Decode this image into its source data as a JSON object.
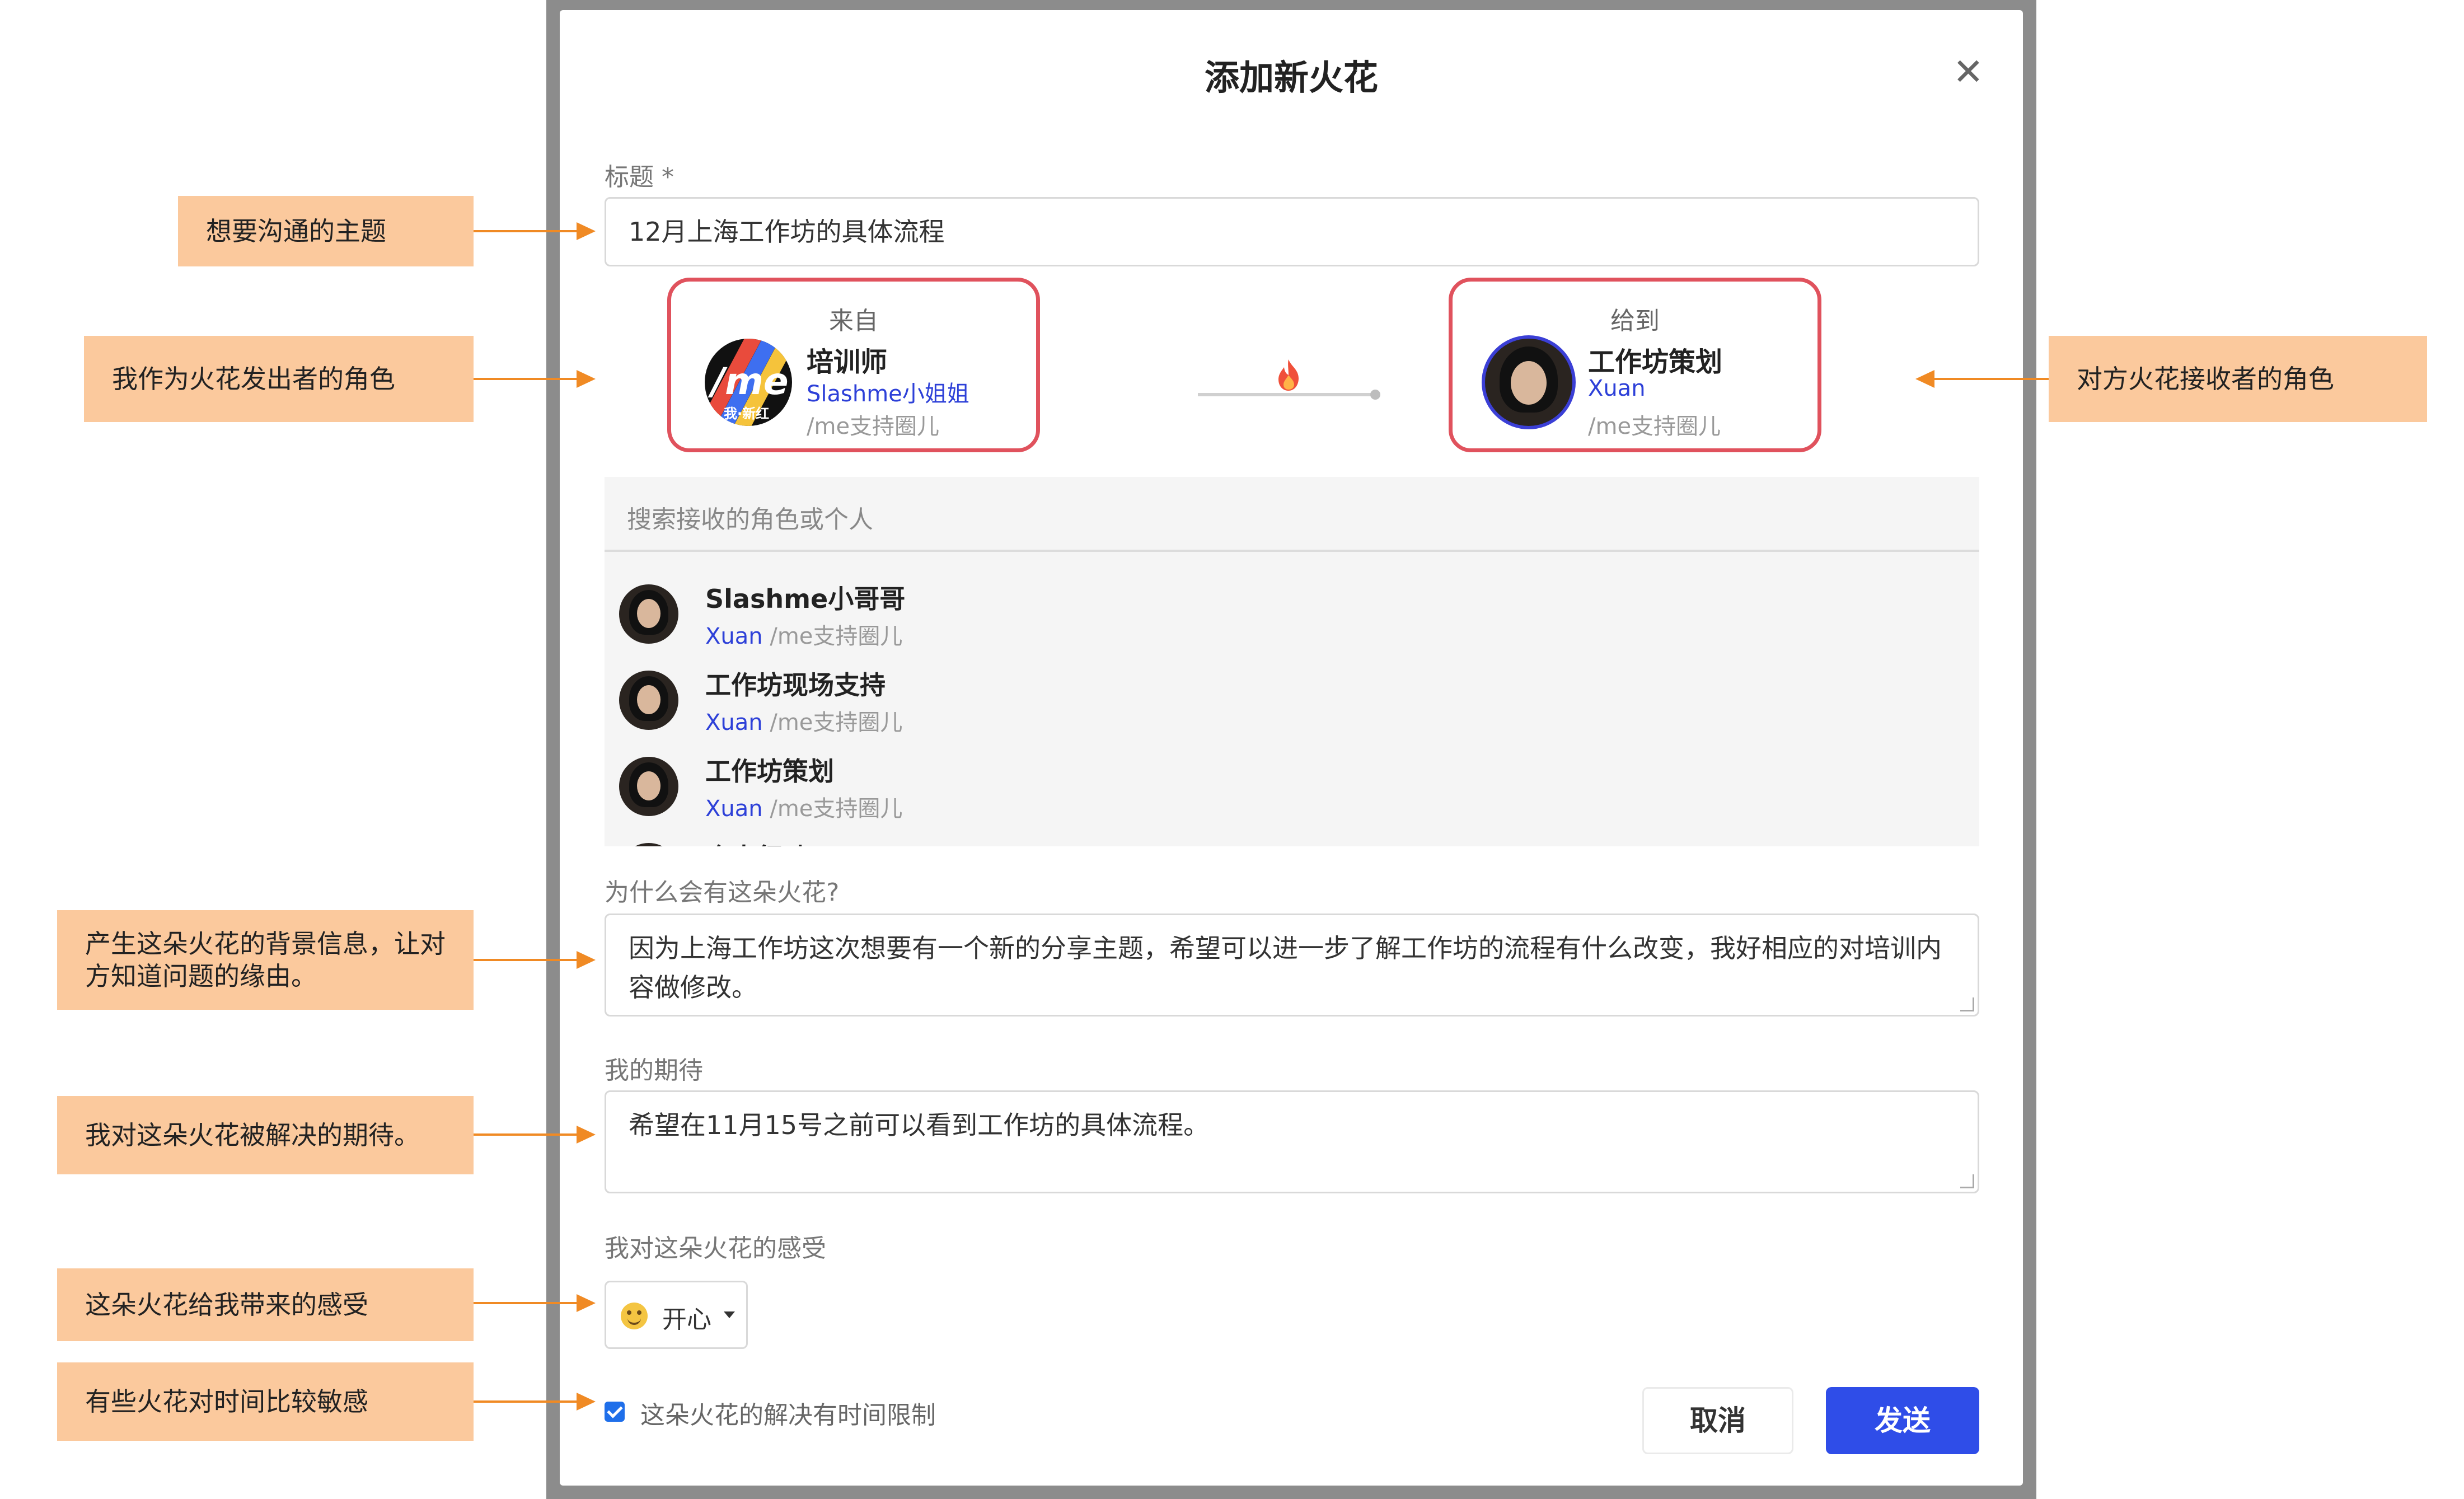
{
  "modal": {
    "title": "添加新火花",
    "close_glyph": "✕",
    "title_label": "标题 *",
    "title_value": "12月上海工作坊的具体流程",
    "from_card": {
      "head": "来自",
      "role": "培训师",
      "person": "Slashme小姐姐",
      "circle": "/me支持圈儿",
      "avatar_text": "/me",
      "avatar_sub": "我·新红"
    },
    "to_card": {
      "head": "给到",
      "role": "工作坊策划",
      "person": "Xuan",
      "circle": "/me支持圈儿"
    },
    "dropdown": {
      "search_placeholder": "搜索接收的角色或个人",
      "items": [
        {
          "name": "Slashme小哥哥",
          "person": "Xuan",
          "circle": "/me支持圈儿"
        },
        {
          "name": "工作坊现场支持",
          "person": "Xuan",
          "circle": "/me支持圈儿"
        },
        {
          "name": "工作坊策划",
          "person": "Xuan",
          "circle": "/me支持圈儿"
        },
        {
          "name": "个人行动",
          "person": "",
          "circle": ""
        }
      ]
    },
    "why_label": "为什么会有这朵火花?",
    "why_value": "因为上海工作坊这次想要有一个新的分享主题，希望可以进一步了解工作坊的流程有什么改变，我好相应的对培训内容做修改。",
    "expect_label": "我的期待",
    "expect_value": "希望在11月15号之前可以看到工作坊的具体流程。",
    "feeling_label": "我对这朵火花的感受",
    "feeling_value": "开心",
    "time_limit_label": "这朵火花的解决有时间限制",
    "time_limit_checked": true,
    "cancel_label": "取消",
    "send_label": "发送"
  },
  "annotations": {
    "topic": "想要沟通的主题",
    "sender_role": "我作为火花发出者的角色",
    "receiver_role": "对方火花接收者的角色",
    "background": "产生这朵火花的背景信息，让对方知道问题的缘由。",
    "expectation": "我对这朵火花被解决的期待。",
    "feeling": "这朵火花给我带来的感受",
    "time_sensitive": "有些火花对时间比较敏感"
  },
  "colors": {
    "accent": "#2f4de8",
    "card_border": "#e0525d",
    "annotation_bg": "#fbc99d",
    "arrow": "#f08a24",
    "link_blue": "#2d40d8"
  },
  "icons": [
    "close-icon",
    "flame-icon",
    "chevron-down-icon",
    "smile-emoji-icon",
    "checkbox-checked-icon"
  ]
}
